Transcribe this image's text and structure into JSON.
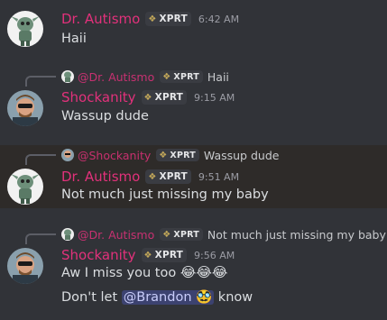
{
  "messages": [
    {
      "username": "Dr. Autismo",
      "badge": "XPRT",
      "timestamp": "6:42 AM",
      "text": "Haii"
    },
    {
      "reply": {
        "username": "@Dr. Autismo",
        "badge": "XPRT",
        "text": "Haii"
      },
      "username": "Shockanity",
      "badge": "XPRT",
      "timestamp": "9:15 AM",
      "text": "Wassup dude"
    },
    {
      "reply": {
        "username": "@Shockanity",
        "badge": "XPRT",
        "text": "Wassup dude"
      },
      "username": "Dr. Autismo",
      "badge": "XPRT",
      "timestamp": "9:51 AM",
      "text": "Not much just missing my baby"
    },
    {
      "reply": {
        "username": "@Dr. Autismo",
        "badge": "XPRT",
        "text": "Not much just missing my baby"
      },
      "username": "Shockanity",
      "badge": "XPRT",
      "timestamp": "9:56 AM",
      "text": "Aw I miss you too",
      "emojis": "😂😂😂",
      "text2_before": "Don't let",
      "mention": "@Brandon",
      "mention_icon": "🥸",
      "text2_after": "know"
    }
  ],
  "colors": {
    "background": "#313338",
    "highlight": "#2e2b29",
    "username": "#e2317b",
    "mention_bg": "#3c4270"
  }
}
